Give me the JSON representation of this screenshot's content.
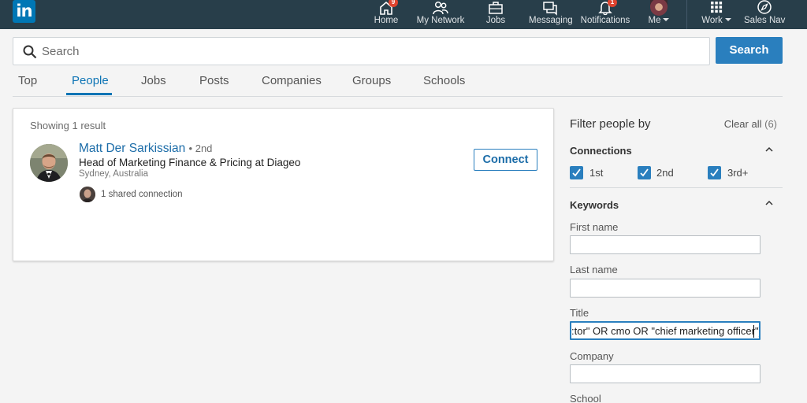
{
  "nav": {
    "logo": "in",
    "items": [
      {
        "label": "Home",
        "badge": "9"
      },
      {
        "label": "My Network",
        "badge": ""
      },
      {
        "label": "Jobs",
        "badge": ""
      },
      {
        "label": "Messaging",
        "badge": ""
      },
      {
        "label": "Notifications",
        "badge": "1"
      },
      {
        "label": "Me",
        "badge": ""
      },
      {
        "label": "Work",
        "badge": ""
      },
      {
        "label": "Sales Nav",
        "badge": ""
      }
    ]
  },
  "search": {
    "placeholder": "Search",
    "button_label": "Search"
  },
  "tabs": [
    "Top",
    "People",
    "Jobs",
    "Posts",
    "Companies",
    "Groups",
    "Schools"
  ],
  "active_tab": "People",
  "results": {
    "showing": "Showing 1 result",
    "items": [
      {
        "name": "Matt Der Sarkissian",
        "degree": "• 2nd",
        "headline": "Head of Marketing Finance & Pricing at Diageo",
        "location": "Sydney, Australia",
        "shared": "1 shared connection",
        "action": "Connect"
      }
    ]
  },
  "filter": {
    "title": "Filter people by",
    "clear_all": "Clear all",
    "clear_count": "(6)",
    "connections_title": "Connections",
    "connections": [
      {
        "label": "1st",
        "checked": true
      },
      {
        "label": "2nd",
        "checked": true
      },
      {
        "label": "3rd+",
        "checked": true
      }
    ],
    "keywords_title": "Keywords",
    "fields": [
      {
        "label": "First name",
        "value": ""
      },
      {
        "label": "Last name",
        "value": ""
      },
      {
        "label": "Title",
        "value": ":tor\" OR cmo OR \"chief marketing officer\")"
      },
      {
        "label": "Company",
        "value": ""
      },
      {
        "label": "School",
        "value": ""
      }
    ]
  },
  "colors": {
    "nav_bg": "#283e4a",
    "brand_blue": "#0077b5",
    "accent": "#2a7fbe",
    "badge_red": "#e0442f"
  }
}
